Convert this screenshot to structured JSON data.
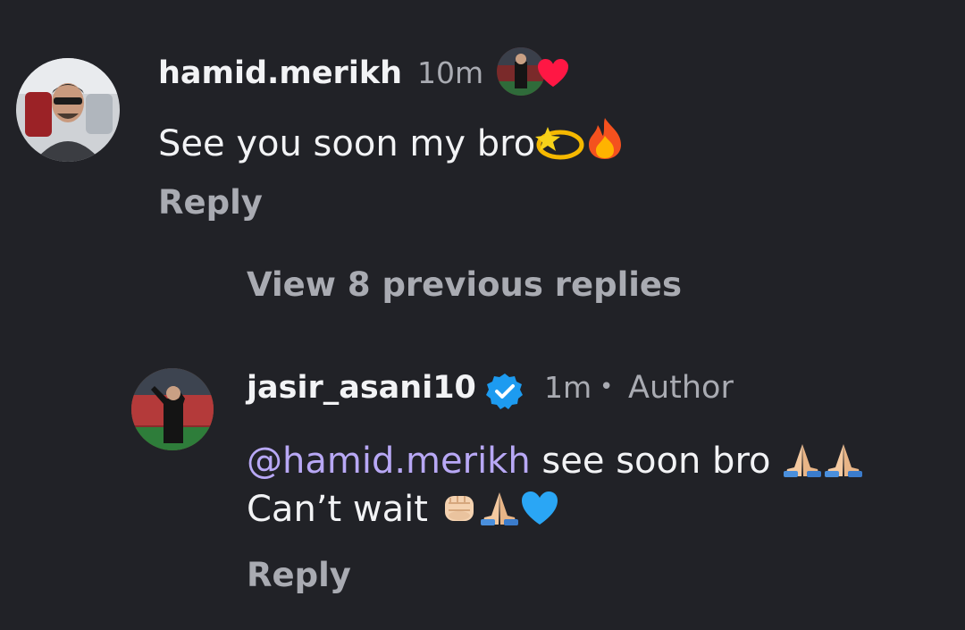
{
  "comment": {
    "username": "hamid.merikh",
    "time": "10m",
    "text": "See you soon my bro",
    "text_emojis": [
      "dizzy-emoji",
      "fire-emoji"
    ],
    "reply_label": "Reply",
    "liked_by_author_icon": "author-avatar-with-heart-icon"
  },
  "thread": {
    "view_previous_label": "View 8 previous replies"
  },
  "reply": {
    "username": "jasir_asani10",
    "verified_icon": "verified-badge-icon",
    "time": "1m",
    "separator": "•",
    "author_label": "Author",
    "mention": "@hamid.merikh",
    "line1_text": "see soon  bro",
    "line1_emojis": [
      "folded-hands-emoji",
      "folded-hands-emoji"
    ],
    "line2_text": "Can’t wait",
    "line2_emojis": [
      "raised-fist-emoji",
      "folded-hands-emoji",
      "blue-heart-emoji"
    ],
    "reply_label": "Reply"
  },
  "colors": {
    "background": "#212227",
    "primary_text": "#f2f3f5",
    "secondary_text": "#a9abb2",
    "mention": "#b8a8f5",
    "verified_blue": "#1d9bf0",
    "heart_red": "#ff1744"
  }
}
